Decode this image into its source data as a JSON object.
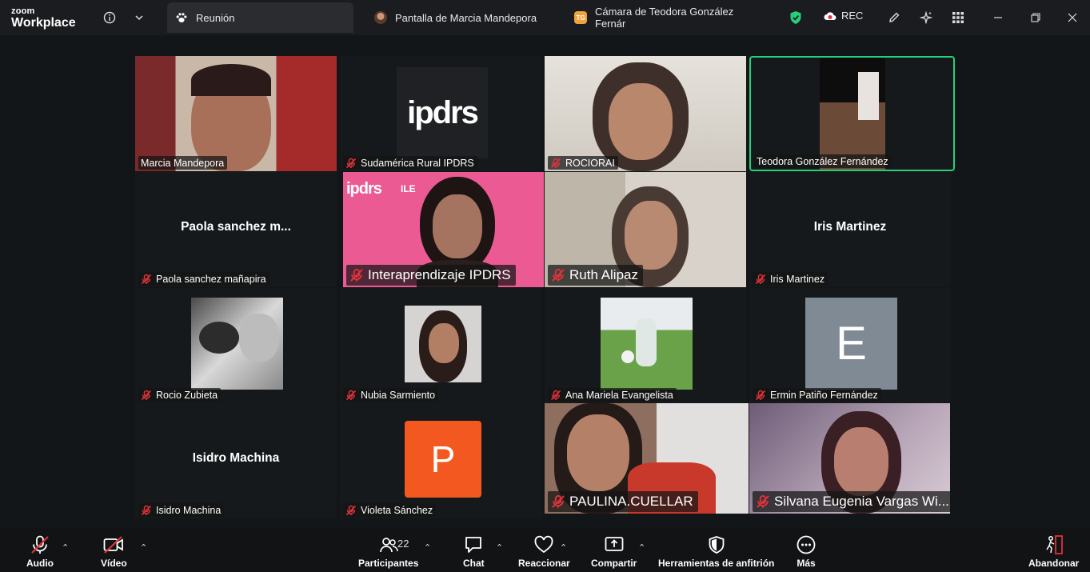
{
  "app": {
    "brand_top": "zoom",
    "brand_bottom": "Workplace"
  },
  "tabs": [
    {
      "label": "Reunión",
      "active": true
    },
    {
      "label": "Pantalla de Marcia Mandepora",
      "active": false
    },
    {
      "label": "Cámara de Teodora González Fernár",
      "active": false,
      "badge": "TG"
    }
  ],
  "topbar": {
    "rec_label": "REC"
  },
  "participants": [
    {
      "name": "Marcia Mandepora",
      "muted": false,
      "video": true
    },
    {
      "name": "Sudamérica Rural IPDRS",
      "muted": true,
      "video": true,
      "logo_text": "ipdrs"
    },
    {
      "name": "ROCIORAI",
      "muted": true,
      "video": true
    },
    {
      "name": "Teodora González Fernández",
      "muted": false,
      "video": true,
      "speaking": true
    },
    {
      "name": "Paola sanchez mañapira",
      "display": "Paola sanchez m...",
      "muted": true,
      "video": false
    },
    {
      "name": "Interaprendizaje IPDRS",
      "muted": true,
      "video": true,
      "logo_text": "ipdrs",
      "logo_text2": "ILE"
    },
    {
      "name": "Ruth Alipaz",
      "muted": true,
      "video": true
    },
    {
      "name": "Iris Martinez",
      "display": "Iris Martinez",
      "muted": true,
      "video": false
    },
    {
      "name": "Rocio Zubieta",
      "muted": true,
      "video": false
    },
    {
      "name": "Nubia Sarmiento",
      "muted": true,
      "video": false
    },
    {
      "name": "Ana Mariela Evangelista",
      "muted": true,
      "video": false
    },
    {
      "name": "Ermin Patiño Fernández",
      "muted": true,
      "video": false,
      "letter": "E"
    },
    {
      "name": "Isidro Machina",
      "display": "Isidro Machina",
      "muted": true,
      "video": false
    },
    {
      "name": "Violeta Sánchez",
      "muted": true,
      "video": false,
      "letter": "P"
    },
    {
      "name": "PAULINA.CUELLAR",
      "muted": true,
      "video": true
    },
    {
      "name": "Silvana Eugenia Vargas Wi...",
      "muted": true,
      "video": true
    }
  ],
  "toolbar": {
    "audio": "Audio",
    "video": "Vídeo",
    "participants": "Participantes",
    "participants_count": "22",
    "chat": "Chat",
    "react": "Reaccionar",
    "share": "Compartir",
    "host_tools": "Herramientas de anfitrión",
    "more": "Más",
    "leave": "Abandonar"
  },
  "colors": {
    "speaking_border": "#25d07a",
    "muted_icon": "#e0323a",
    "shield": "#25d07a",
    "rec_dot": "#e0323a",
    "leave_accent": "#e0323a",
    "ermin_avatar": "#7f8a94",
    "violeta_avatar": "#f2581f",
    "interaprendizaje_bg": "#ec5a93"
  }
}
